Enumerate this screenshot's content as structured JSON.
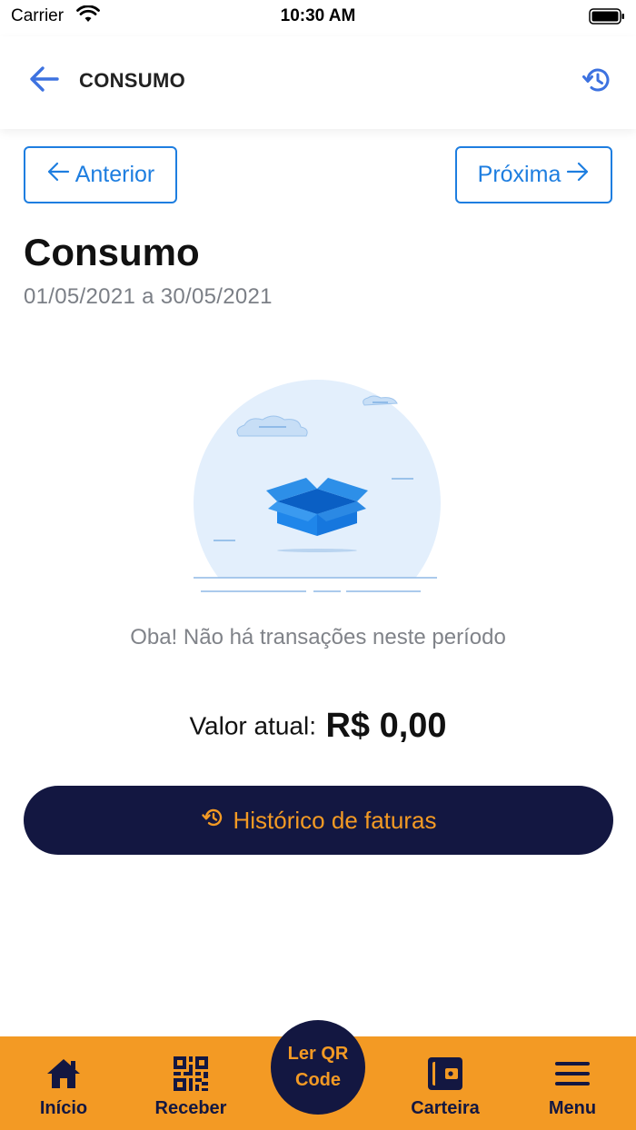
{
  "status_bar": {
    "carrier": "Carrier",
    "time": "10:30 AM"
  },
  "header": {
    "title": "CONSUMO",
    "back_icon": "arrow-left-icon",
    "history_icon": "history-icon"
  },
  "navigation": {
    "previous_label": "Anterior",
    "next_label": "Próxima"
  },
  "page": {
    "title": "Consumo",
    "period": "01/05/2021 a 30/05/2021"
  },
  "empty_state": {
    "message": "Oba! Não há transações neste período",
    "illustration": "empty-box-illustration"
  },
  "summary": {
    "label": "Valor atual:",
    "amount": "R$ 0,00"
  },
  "invoices_button": {
    "label": "Histórico de faturas",
    "icon": "history-icon"
  },
  "tab_bar": {
    "items": [
      {
        "label": "Início",
        "icon": "home-icon"
      },
      {
        "label": "Receber",
        "icon": "qr-code-icon"
      },
      {
        "label": "Carteira",
        "icon": "wallet-icon"
      },
      {
        "label": "Menu",
        "icon": "menu-icon"
      }
    ],
    "fab_line1": "Ler QR",
    "fab_line2": "Code"
  },
  "colors": {
    "accent_blue": "#1e7ee0",
    "navy": "#131741",
    "orange": "#f39a24",
    "muted_text": "#7b7f86"
  }
}
